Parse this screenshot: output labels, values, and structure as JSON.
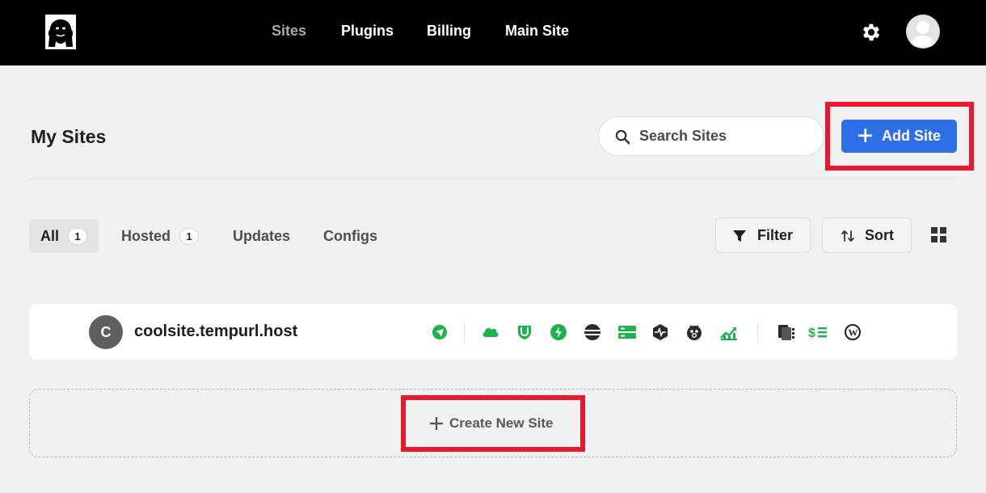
{
  "header": {
    "logo_icon": "gorilla-logo-icon",
    "nav": [
      {
        "label": "Sites",
        "active": true
      },
      {
        "label": "Plugins",
        "active": false
      },
      {
        "label": "Billing",
        "active": false
      },
      {
        "label": "Main Site",
        "active": false
      }
    ],
    "settings_icon": "gear-icon",
    "avatar_icon": "user-avatar-icon"
  },
  "page": {
    "title": "My Sites",
    "search": {
      "placeholder": "Search Sites",
      "value": ""
    },
    "add_site_label": "Add Site"
  },
  "tabs": [
    {
      "label": "All",
      "count": "1",
      "active": true
    },
    {
      "label": "Hosted",
      "count": "1",
      "active": false
    },
    {
      "label": "Updates",
      "count": null,
      "active": false
    },
    {
      "label": "Configs",
      "count": null,
      "active": false
    }
  ],
  "toolbar": {
    "filter_label": "Filter",
    "sort_label": "Sort",
    "view_icon": "grid-view-icon"
  },
  "sites": [
    {
      "initial": "C",
      "name": "coolsite.tempurl.host",
      "status_icons": [
        "ssl-icon",
        "cdn-cloud-icon",
        "firewall-shield-icon",
        "speed-bolt-icon",
        "server-stack-icon",
        "hosting-icon",
        "uptime-monitor-icon",
        "malware-scan-icon",
        "seo-chart-icon",
        "backups-icon",
        "billing-icon",
        "wordpress-icon"
      ]
    }
  ],
  "create_new_label": "Create New Site",
  "colors": {
    "accent_blue": "#2e6ee6",
    "status_green": "#1bb34a",
    "highlight_red": "#e8192c",
    "topbar": "#000000"
  }
}
